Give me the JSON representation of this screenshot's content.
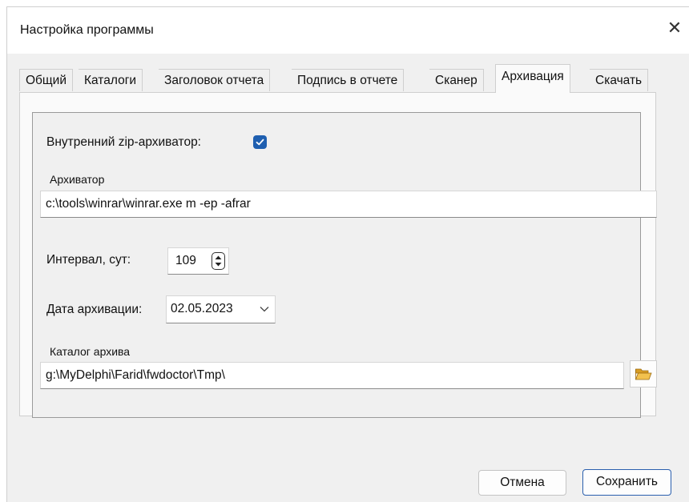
{
  "window": {
    "title": "Настройка программы",
    "close_glyph": "✕"
  },
  "tabs": [
    {
      "label": "Общий"
    },
    {
      "label": "Каталоги"
    },
    {
      "label": "Заголовок отчета"
    },
    {
      "label": "Подпись в отчете"
    },
    {
      "label": "Сканер"
    },
    {
      "label": "Архивация",
      "active": true
    },
    {
      "label": "Скачать"
    }
  ],
  "archive": {
    "zip_label": "Внутренний zip-архиватор:",
    "zip_checked": true,
    "archiver_label": "Архиватор",
    "archiver_value": "c:\\tools\\winrar\\winrar.exe m -ep -afrar",
    "interval_label": "Интервал, сут:",
    "interval_value": "109",
    "date_label": "Дата архивации:",
    "date_value": "02.05.2023",
    "catalog_label": "Каталог архива",
    "catalog_value": "g:\\MyDelphi\\Farid\\fwdoctor\\Tmp\\"
  },
  "buttons": {
    "cancel": "Отмена",
    "save": "Сохранить"
  },
  "colors": {
    "accent": "#1f5fb0",
    "folder": "#e8b53a"
  },
  "icons": [
    "close-icon",
    "checkmark-icon",
    "spin-arrows-icon",
    "chevron-down-icon",
    "folder-open-icon"
  ]
}
